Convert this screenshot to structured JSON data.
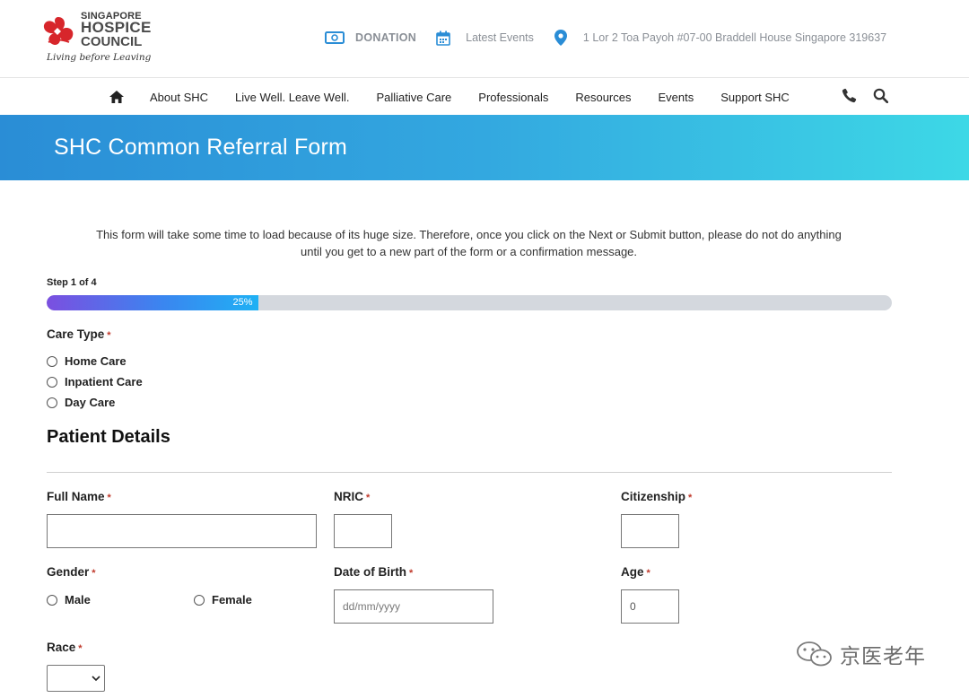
{
  "header": {
    "logo_small": "SINGAPORE",
    "logo_line1": "HOSPICE",
    "logo_line2": "COUNCIL",
    "logo_tagline": "Living before Leaving",
    "donation": "DONATION",
    "events": "Latest Events",
    "address": "1 Lor 2 Toa Payoh #07-00 Braddell House Singapore 319637",
    "icon_color": "#2a8dd6"
  },
  "nav": {
    "items": [
      "About SHC",
      "Live Well. Leave Well.",
      "Palliative Care",
      "Professionals",
      "Resources",
      "Events",
      "Support SHC"
    ]
  },
  "banner": {
    "title": "SHC Common Referral Form"
  },
  "form": {
    "notice": "This form will take some time to load because of its huge size. Therefore, once you click on the Next or Submit button, please do not do anything until you get to a new part of the form or a confirmation message.",
    "step_label": "Step 1 of 4",
    "progress_value": 25,
    "progress_text": "25%",
    "required_mark": "*",
    "care_type": {
      "label": "Care Type",
      "options": [
        "Home Care",
        "Inpatient Care",
        "Day Care"
      ]
    },
    "section_title": "Patient Details",
    "full_name": {
      "label": "Full Name",
      "value": ""
    },
    "nric": {
      "label": "NRIC",
      "value": ""
    },
    "citizenship": {
      "label": "Citizenship",
      "value": ""
    },
    "gender": {
      "label": "Gender",
      "options": [
        "Male",
        "Female"
      ]
    },
    "dob": {
      "label": "Date of Birth",
      "placeholder": "dd/mm/yyyy"
    },
    "age": {
      "label": "Age",
      "value": "0"
    },
    "race": {
      "label": "Race",
      "value": ""
    }
  },
  "watermark": "京医老年",
  "colors": {
    "brand_red": "#d7262b",
    "banner_start": "#2a8dd6",
    "banner_end": "#3dd8e6",
    "required": "#c0392b"
  }
}
